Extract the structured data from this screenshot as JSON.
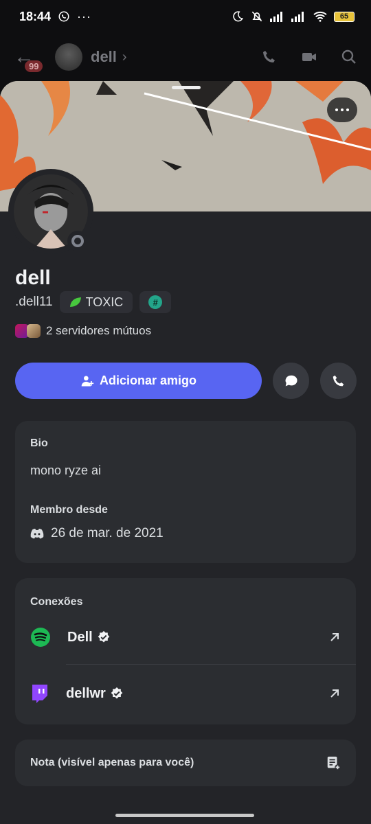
{
  "status_bar": {
    "time": "18:44",
    "battery": "65"
  },
  "chat_header": {
    "badge": "99",
    "name": "dell"
  },
  "profile": {
    "display_name": "dell",
    "username": ".dell11",
    "tag_label": "TOXIC",
    "mutual_servers": "2 servidores mútuos",
    "add_friend_label": "Adicionar amigo"
  },
  "bio": {
    "label": "Bio",
    "text": "mono ryze ai",
    "member_since_label": "Membro desde",
    "member_since": "26 de mar. de 2021"
  },
  "connections": {
    "title": "Conexões",
    "items": [
      {
        "service": "spotify-icon",
        "name": "Dell",
        "color": "#1db954"
      },
      {
        "service": "twitch-icon",
        "name": "dellwr",
        "color": "#9146ff"
      }
    ]
  },
  "note": {
    "label": "Nota (visível apenas para você)"
  },
  "colors": {
    "accent": "#5865f2",
    "background": "#232428",
    "card": "#2b2d31"
  }
}
